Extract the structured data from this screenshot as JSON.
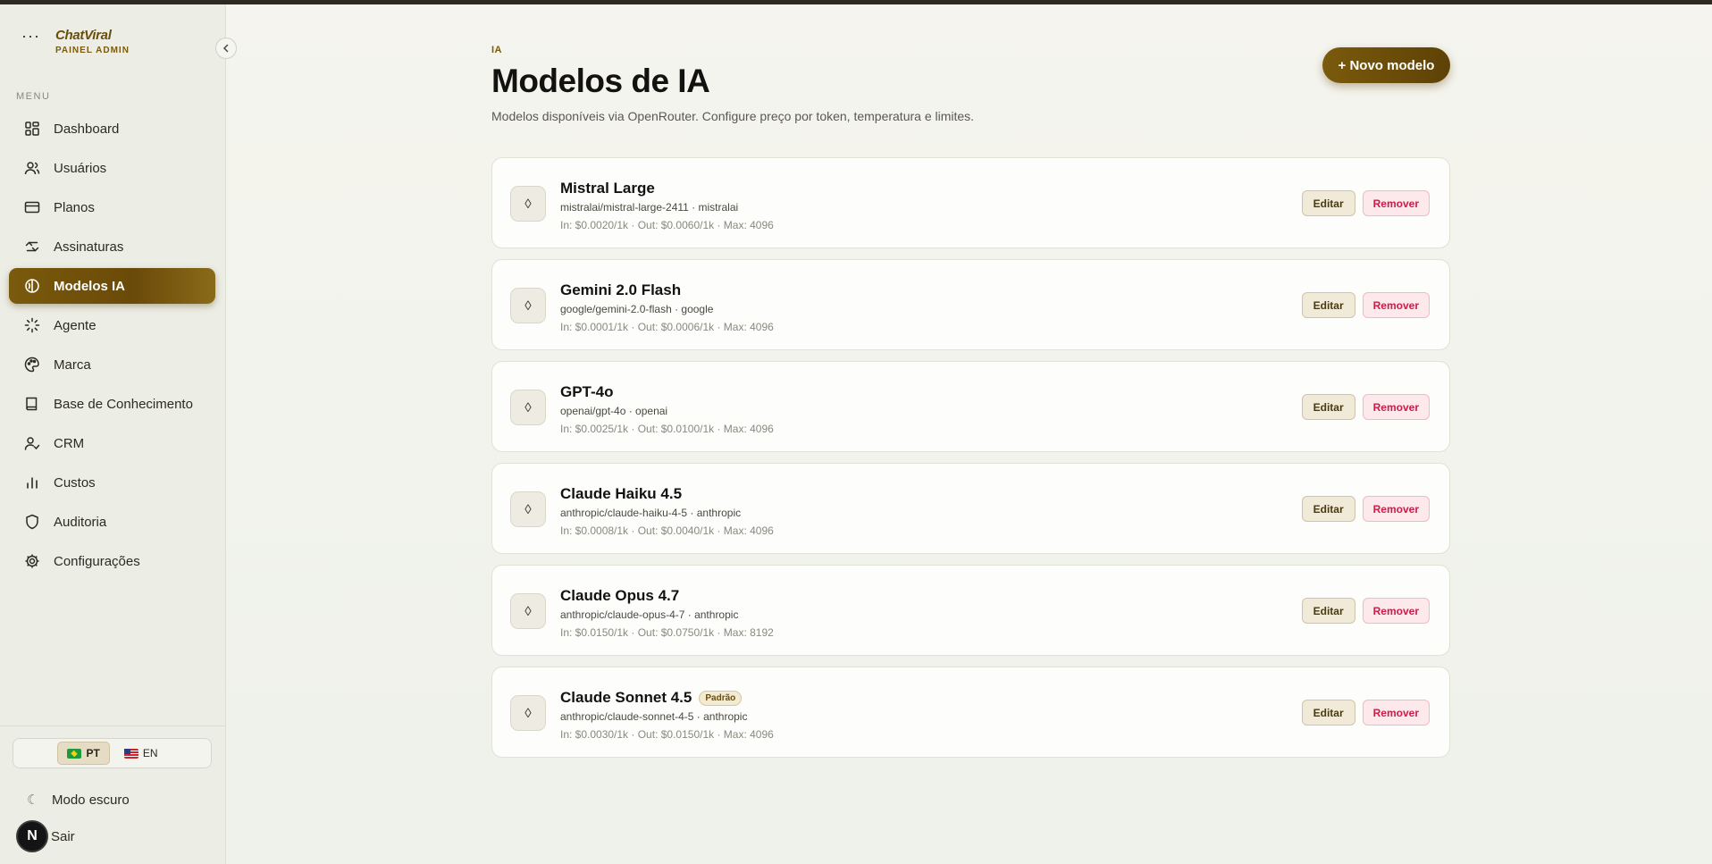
{
  "brand": {
    "name": "ChatViral",
    "subtitle": "PAINEL ADMIN",
    "menu_icon": "dots-icon"
  },
  "sidebar": {
    "menu_label": "MENU",
    "items": [
      {
        "label": "Dashboard",
        "icon": "dashboard-icon",
        "active": false
      },
      {
        "label": "Usuários",
        "icon": "users-icon",
        "active": false
      },
      {
        "label": "Planos",
        "icon": "credit-card-icon",
        "active": false
      },
      {
        "label": "Assinaturas",
        "icon": "repeat-icon",
        "active": false
      },
      {
        "label": "Modelos IA",
        "icon": "brain-icon",
        "active": true
      },
      {
        "label": "Agente",
        "icon": "spark-icon",
        "active": false
      },
      {
        "label": "Marca",
        "icon": "palette-icon",
        "active": false
      },
      {
        "label": "Base de Conhecimento",
        "icon": "book-icon",
        "active": false
      },
      {
        "label": "CRM",
        "icon": "user-check-icon",
        "active": false
      },
      {
        "label": "Custos",
        "icon": "bar-chart-icon",
        "active": false
      },
      {
        "label": "Auditoria",
        "icon": "shield-icon",
        "active": false
      },
      {
        "label": "Configurações",
        "icon": "gear-icon",
        "active": false
      }
    ],
    "languages": [
      {
        "label": "PT",
        "flag": "brazil-flag",
        "active": true
      },
      {
        "label": "EN",
        "flag": "us-flag",
        "active": false
      }
    ],
    "dark_mode_label": "Modo escuro",
    "logout_label": "Sair",
    "avatar_letter": "N"
  },
  "main": {
    "eyebrow": "IA",
    "title": "Modelos de IA",
    "subtitle": "Modelos disponíveis via OpenRouter. Configure preço por token, temperatura e limites.",
    "new_button": "+ Novo modelo",
    "edit_label": "Editar",
    "remove_label": "Remover",
    "models": [
      {
        "name": "Mistral Large",
        "id": "mistralai/mistral-large-2411 · mistralai",
        "price": "In: $0.0020/1k · Out: $0.0060/1k · Max: 4096",
        "badge": ""
      },
      {
        "name": "Gemini 2.0 Flash",
        "id": "google/gemini-2.0-flash · google",
        "price": "In: $0.0001/1k · Out: $0.0006/1k · Max: 4096",
        "badge": ""
      },
      {
        "name": "GPT-4o",
        "id": "openai/gpt-4o · openai",
        "price": "In: $0.0025/1k · Out: $0.0100/1k · Max: 4096",
        "badge": ""
      },
      {
        "name": "Claude Haiku 4.5",
        "id": "anthropic/claude-haiku-4-5 · anthropic",
        "price": "In: $0.0008/1k · Out: $0.0040/1k · Max: 4096",
        "badge": ""
      },
      {
        "name": "Claude Opus 4.7",
        "id": "anthropic/claude-opus-4-7 · anthropic",
        "price": "In: $0.0150/1k · Out: $0.0750/1k · Max: 8192",
        "badge": ""
      },
      {
        "name": "Claude Sonnet 4.5",
        "id": "anthropic/claude-sonnet-4-5 · anthropic",
        "price": "In: $0.0030/1k · Out: $0.0150/1k · Max: 4096",
        "badge": "Padrão"
      }
    ]
  }
}
